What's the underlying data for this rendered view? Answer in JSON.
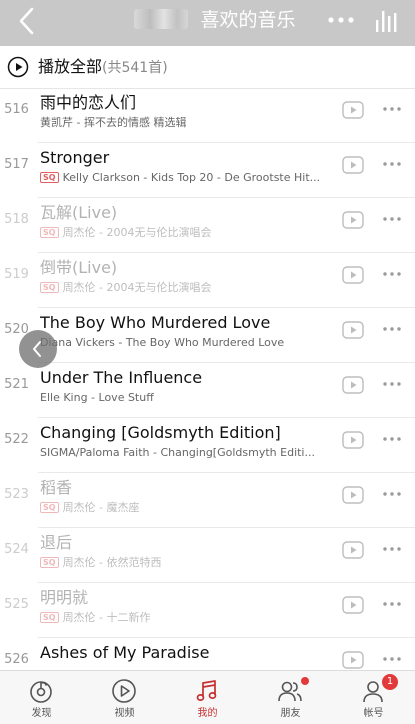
{
  "header": {
    "title": "喜欢的音乐",
    "background": "#c8c8c8"
  },
  "playall": {
    "label": "播放全部",
    "count": "(共541首)"
  },
  "songs": [
    {
      "num": "516",
      "title": "雨中的恋人们",
      "sub": "黄凯芹 - 挥不去的情感 精选辑",
      "sq": false,
      "dim": false
    },
    {
      "num": "517",
      "title": "Stronger",
      "sub": "Kelly Clarkson - Kids Top 20 - De Grootste Hit...",
      "sq": true,
      "dim": false
    },
    {
      "num": "518",
      "title": "瓦解(Live)",
      "sub": "周杰伦 - 2004无与伦比演唱会",
      "sq": true,
      "dim": true
    },
    {
      "num": "519",
      "title": "倒带(Live)",
      "sub": "周杰伦 - 2004无与伦比演唱会",
      "sq": true,
      "dim": true
    },
    {
      "num": "520",
      "title": "The Boy Who Murdered Love",
      "sub": "Diana Vickers - The Boy Who Murdered Love",
      "sq": false,
      "dim": false
    },
    {
      "num": "521",
      "title": "Under The Influence",
      "sub": "Elle King - Love Stuff",
      "sq": false,
      "dim": false
    },
    {
      "num": "522",
      "title": "Changing [Goldsmyth Edition]",
      "sub": "SIGMA/Paloma Faith - Changing[Goldsmyth Editi...",
      "sq": false,
      "dim": false
    },
    {
      "num": "523",
      "title": "稻香",
      "sub": "周杰伦 - 魔杰座",
      "sq": true,
      "dim": true
    },
    {
      "num": "524",
      "title": "退后",
      "sub": "周杰伦 - 依然范特西",
      "sq": true,
      "dim": true
    },
    {
      "num": "525",
      "title": "明明就",
      "sub": "周杰伦 - 十二新作",
      "sq": true,
      "dim": true
    },
    {
      "num": "526",
      "title": "Ashes of My Paradise",
      "sub": "",
      "sq": false,
      "dim": false
    }
  ],
  "sq_label": "SQ",
  "tabs": [
    {
      "label": "发现",
      "icon": "discover-icon",
      "active": false
    },
    {
      "label": "视频",
      "icon": "video-icon",
      "active": false
    },
    {
      "label": "我的",
      "icon": "music-note-icon",
      "active": true
    },
    {
      "label": "朋友",
      "icon": "friends-icon",
      "active": false,
      "dot": true
    },
    {
      "label": "帐号",
      "icon": "account-icon",
      "active": false,
      "badge": "1"
    }
  ],
  "colors": {
    "accent": "#c62f2f",
    "badge": "#e23a3a",
    "sq": "#e06060"
  }
}
